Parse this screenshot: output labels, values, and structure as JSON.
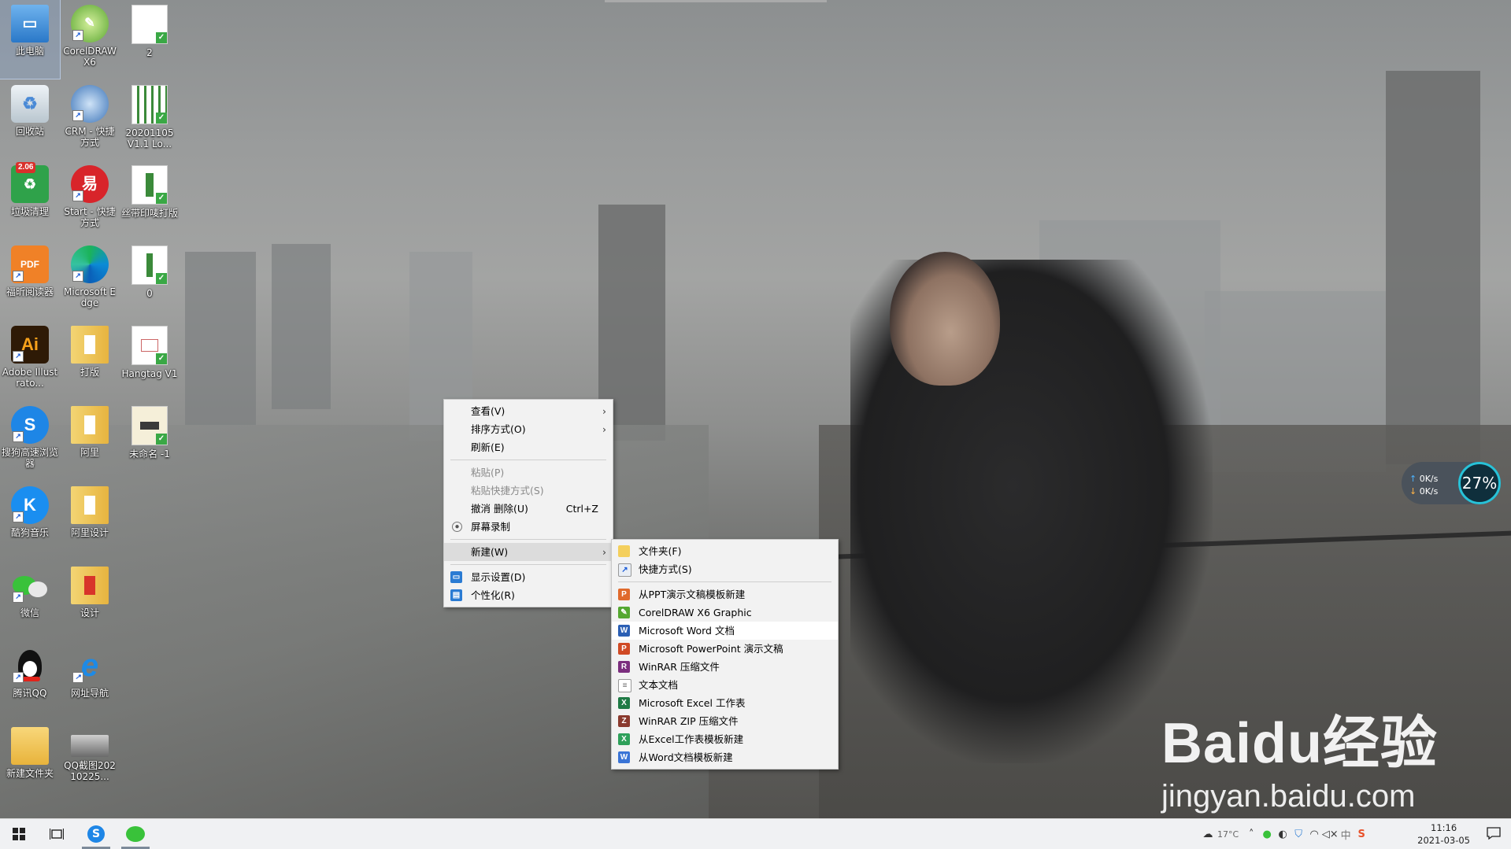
{
  "desktop": {
    "icons": [
      {
        "label": "此电脑",
        "selected": true
      },
      {
        "label": "CorelDRAW X6"
      },
      {
        "label": "2"
      },
      {
        "label": "回收站"
      },
      {
        "label": "CRM - 快捷方式"
      },
      {
        "label": "20201105 V1.1 Lo..."
      },
      {
        "label": "垃圾清理",
        "badge": "2.06"
      },
      {
        "label": "Start - 快捷方式"
      },
      {
        "label": "丝带印唛打版"
      },
      {
        "label": "福昕阅读器",
        "icon_text": "PDF"
      },
      {
        "label": "Microsoft Edge"
      },
      {
        "label": "0"
      },
      {
        "label": "Adobe Illustrato...",
        "icon_text": "Ai"
      },
      {
        "label": "打版"
      },
      {
        "label": "Hangtag V1"
      },
      {
        "label": "搜狗高速浏览器",
        "icon_text": "S"
      },
      {
        "label": "阿里"
      },
      {
        "label": "未命名 -1"
      },
      {
        "label": "酷狗音乐",
        "icon_text": "K"
      },
      {
        "label": "阿里设计"
      },
      {
        "label": "微信"
      },
      {
        "label": "设计"
      },
      {
        "label": "腾讯QQ"
      },
      {
        "label": "网址导航",
        "icon_text": "e"
      },
      {
        "label": "新建文件夹"
      },
      {
        "label": "QQ截图20210225..."
      }
    ]
  },
  "context_menu": {
    "items": [
      {
        "label": "查看(V)",
        "submenu": true
      },
      {
        "label": "排序方式(O)",
        "submenu": true
      },
      {
        "label": "刷新(E)"
      },
      {
        "label": "粘贴(P)",
        "disabled": true
      },
      {
        "label": "粘贴快捷方式(S)",
        "disabled": true
      },
      {
        "label": "撤消 删除(U)",
        "shortcut": "Ctrl+Z"
      },
      {
        "label": "屏幕录制"
      },
      {
        "label": "新建(W)",
        "submenu": true
      },
      {
        "label": "显示设置(D)"
      },
      {
        "label": "个性化(R)"
      }
    ]
  },
  "new_submenu": {
    "items": [
      {
        "label": "文件夹(F)",
        "icon": "folder-icon"
      },
      {
        "label": "快捷方式(S)",
        "icon": "shortcut-icon"
      },
      {
        "label": "从PPT演示文稿模板新建",
        "icon": "ppt-template-icon"
      },
      {
        "label": "CorelDRAW X6 Graphic",
        "icon": "coreldraw-icon"
      },
      {
        "label": "Microsoft Word 文档",
        "icon": "word-icon",
        "hover": true
      },
      {
        "label": "Microsoft PowerPoint 演示文稿",
        "icon": "powerpoint-icon"
      },
      {
        "label": "WinRAR 压缩文件",
        "icon": "winrar-icon"
      },
      {
        "label": "文本文档",
        "icon": "text-doc-icon"
      },
      {
        "label": "Microsoft Excel 工作表",
        "icon": "excel-icon"
      },
      {
        "label": "WinRAR ZIP 压缩文件",
        "icon": "winrar-zip-icon"
      },
      {
        "label": "从Excel工作表模板新建",
        "icon": "excel-template-icon"
      },
      {
        "label": "从Word文档模板新建",
        "icon": "word-template-icon"
      }
    ]
  },
  "net_widget": {
    "up": "0K/s",
    "down": "0K/s",
    "cpu": "27%"
  },
  "taskbar": {
    "weather": "17°C",
    "time": "11:16",
    "date": "2021-03-05"
  },
  "watermark": {
    "brand": "Baidu经验",
    "url": "jingyan.baidu.com"
  },
  "colors": {
    "menu_bg": "#f2f2f2",
    "menu_hover": "#dcdcdc",
    "taskbar_bg": "#f0f1f3",
    "accent": "#0078d7"
  }
}
